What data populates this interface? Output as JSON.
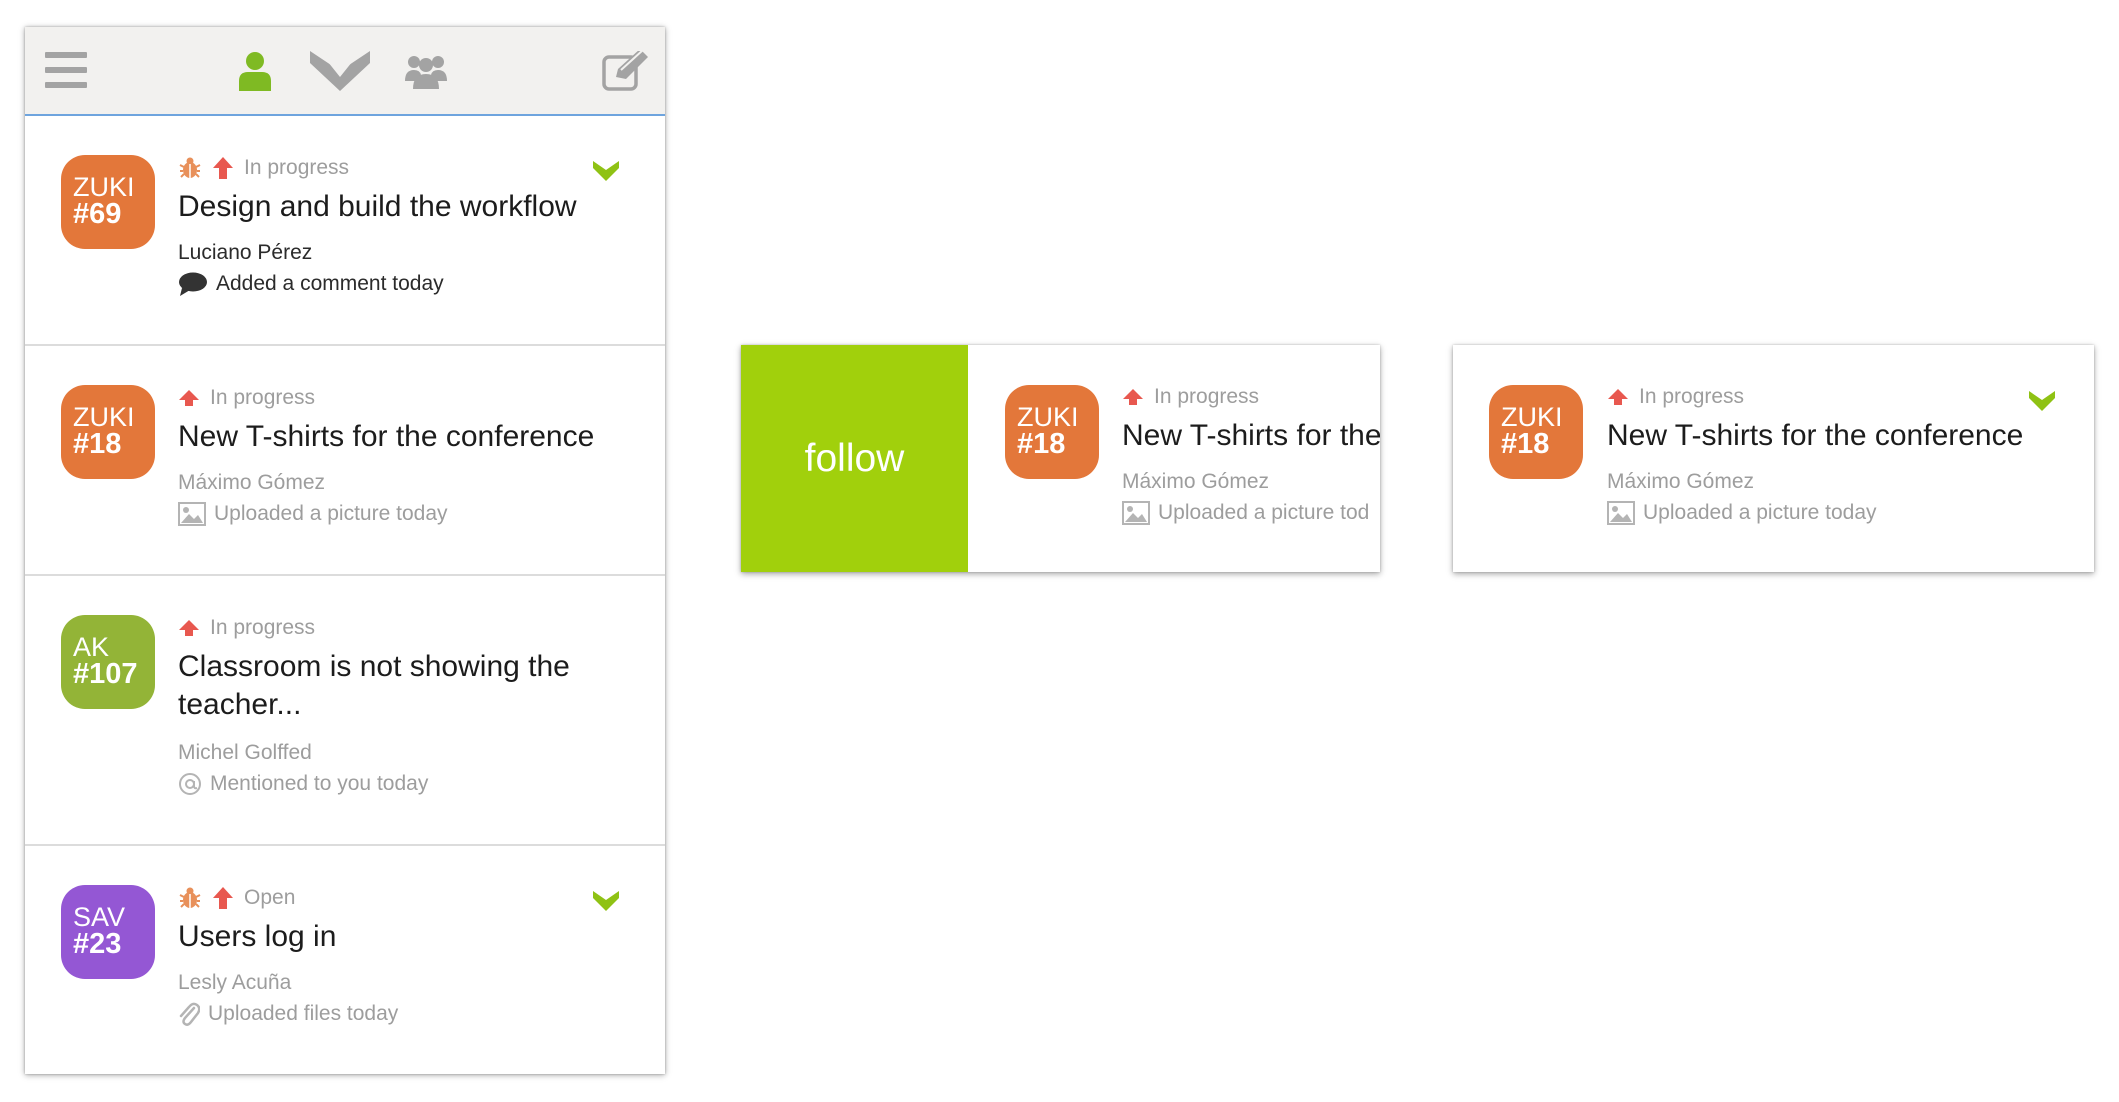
{
  "navbar": {
    "icons": [
      "menu-icon",
      "user-icon",
      "follow-logo-icon",
      "team-icon",
      "compose-icon"
    ],
    "active_color": "#7fba23",
    "icon_color": "#a3a3a3"
  },
  "tasks": [
    {
      "project": "ZUKI",
      "number": "#69",
      "badge_color": "#e3773a",
      "type_icons": [
        "bug-icon",
        "priority-up-icon"
      ],
      "status": "In progress",
      "title": "Design and build the workflow",
      "user": "Luciano Pérez",
      "activity_icon": "comment-icon",
      "activity": "Added a comment today",
      "unread": true,
      "followed": true
    },
    {
      "project": "ZUKI",
      "number": "#18",
      "badge_color": "#e3773a",
      "type_icons": [
        "priority-up-icon"
      ],
      "status": "In progress",
      "title": "New T-shirts for the conference",
      "user": "Máximo Gómez",
      "activity_icon": "picture-icon",
      "activity": "Uploaded a picture today",
      "unread": false,
      "followed": false
    },
    {
      "project": "AK",
      "number": "#107",
      "badge_color": "#93b437",
      "type_icons": [
        "priority-up-icon"
      ],
      "status": "In progress",
      "title": "Classroom is not showing the teacher...",
      "user": "Michel Golffed",
      "activity_icon": "mention-icon",
      "activity": "Mentioned to you today",
      "unread": false,
      "followed": false
    },
    {
      "project": "SAV",
      "number": "#23",
      "badge_color": "#9457d4",
      "type_icons": [
        "bug-icon",
        "priority-up-icon"
      ],
      "status": "Open",
      "title": "Users log in",
      "user": "Lesly Acuña",
      "activity_icon": "paperclip-icon",
      "activity": "Uploaded files today",
      "unread": false,
      "followed": true
    }
  ],
  "swipe_demo": {
    "action_label": "follow",
    "action_color": "#a1d00c",
    "card": {
      "project": "ZUKI",
      "number": "#18",
      "status": "In progress",
      "title": "New T-shirts for the",
      "user": "Máximo Gómez",
      "activity": "Uploaded a picture tod"
    }
  },
  "followed_demo": {
    "card": {
      "project": "ZUKI",
      "number": "#18",
      "status": "In progress",
      "title": "New T-shirts for the conference",
      "user": "Máximo Gómez",
      "activity": "Uploaded a picture today",
      "followed": true
    }
  },
  "colors": {
    "priority": "#e8584f",
    "bug": "#e8905a",
    "follow_green": "#8fc214",
    "separator_blue": "#6ea4de"
  }
}
